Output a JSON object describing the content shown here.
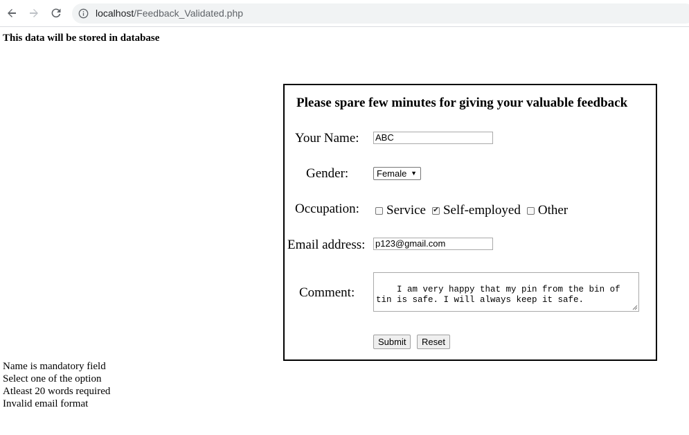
{
  "browser": {
    "url_host": "localhost",
    "url_path": "/Feedback_Validated.php",
    "back_icon": "arrow-left-icon",
    "forward_icon": "arrow-right-icon",
    "reload_icon": "reload-icon",
    "info_icon": "info-icon"
  },
  "page": {
    "notice": "This data will be stored in database"
  },
  "form": {
    "title": "Please spare few minutes for giving your valuable feedback",
    "name_label": "Your Name:",
    "name_value": "ABC",
    "gender_label": "Gender:",
    "gender_value": "Female",
    "occupation_label": "Occupation:",
    "occupation_options": [
      {
        "label": "Service",
        "checked": false
      },
      {
        "label": "Self-employed",
        "checked": true
      },
      {
        "label": "Other",
        "checked": false
      }
    ],
    "email_label": "Email address:",
    "email_value": "p123@gmail.com",
    "comment_label": "Comment:",
    "comment_value": "I am very happy that my pin from the bin of tin is safe. I will always keep it safe.",
    "submit_label": "Submit",
    "reset_label": "Reset"
  },
  "errors": [
    "Name is mandatory field",
    "Select one of the option",
    "Atleast 20 words required",
    "Invalid email format"
  ]
}
